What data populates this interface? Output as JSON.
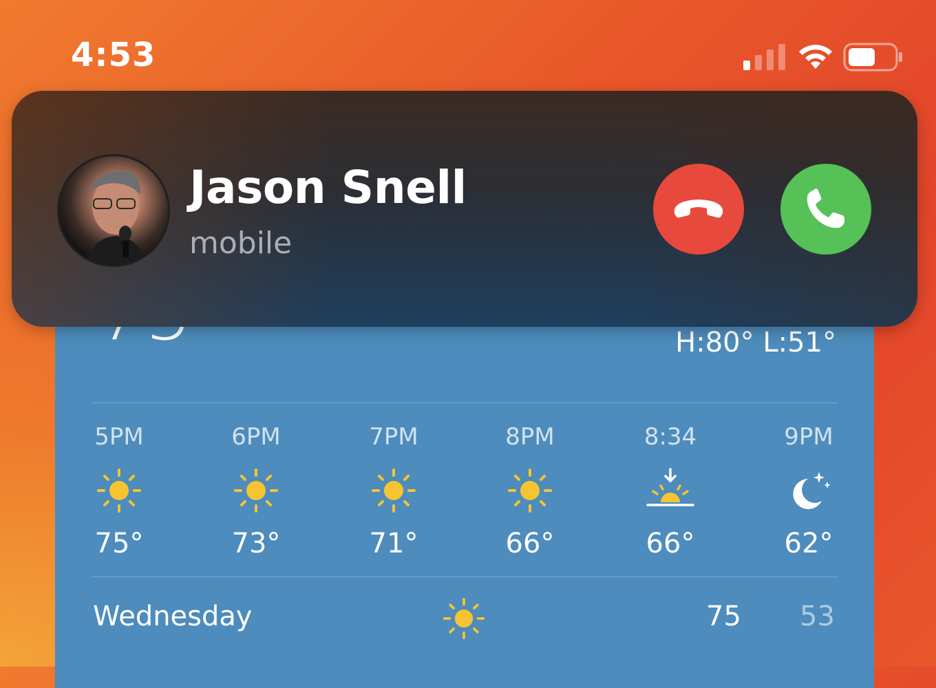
{
  "status_bar": {
    "time": "4:53",
    "icons": [
      "cellular-signal-icon",
      "wifi-icon",
      "battery-icon"
    ]
  },
  "call": {
    "caller_name": "Jason Snell",
    "caller_label": "mobile",
    "decline_icon": "phone-down-icon",
    "accept_icon": "phone-icon",
    "colors": {
      "decline": "#e8493d",
      "accept": "#55c157"
    }
  },
  "weather": {
    "current_temp": "75",
    "high_low": "H:80° L:51°",
    "hourly": [
      {
        "time": "5PM",
        "icon": "sun-icon",
        "temp": "75°"
      },
      {
        "time": "6PM",
        "icon": "sun-icon",
        "temp": "73°"
      },
      {
        "time": "7PM",
        "icon": "sun-icon",
        "temp": "71°"
      },
      {
        "time": "8PM",
        "icon": "sun-icon",
        "temp": "66°"
      },
      {
        "time": "8:34",
        "icon": "sunset-icon",
        "temp": "66°"
      },
      {
        "time": "9PM",
        "icon": "moon-stars-icon",
        "temp": "62°"
      }
    ],
    "daily": [
      {
        "day": "Wednesday",
        "icon": "sun-icon",
        "high": "75",
        "low": "53"
      }
    ]
  }
}
